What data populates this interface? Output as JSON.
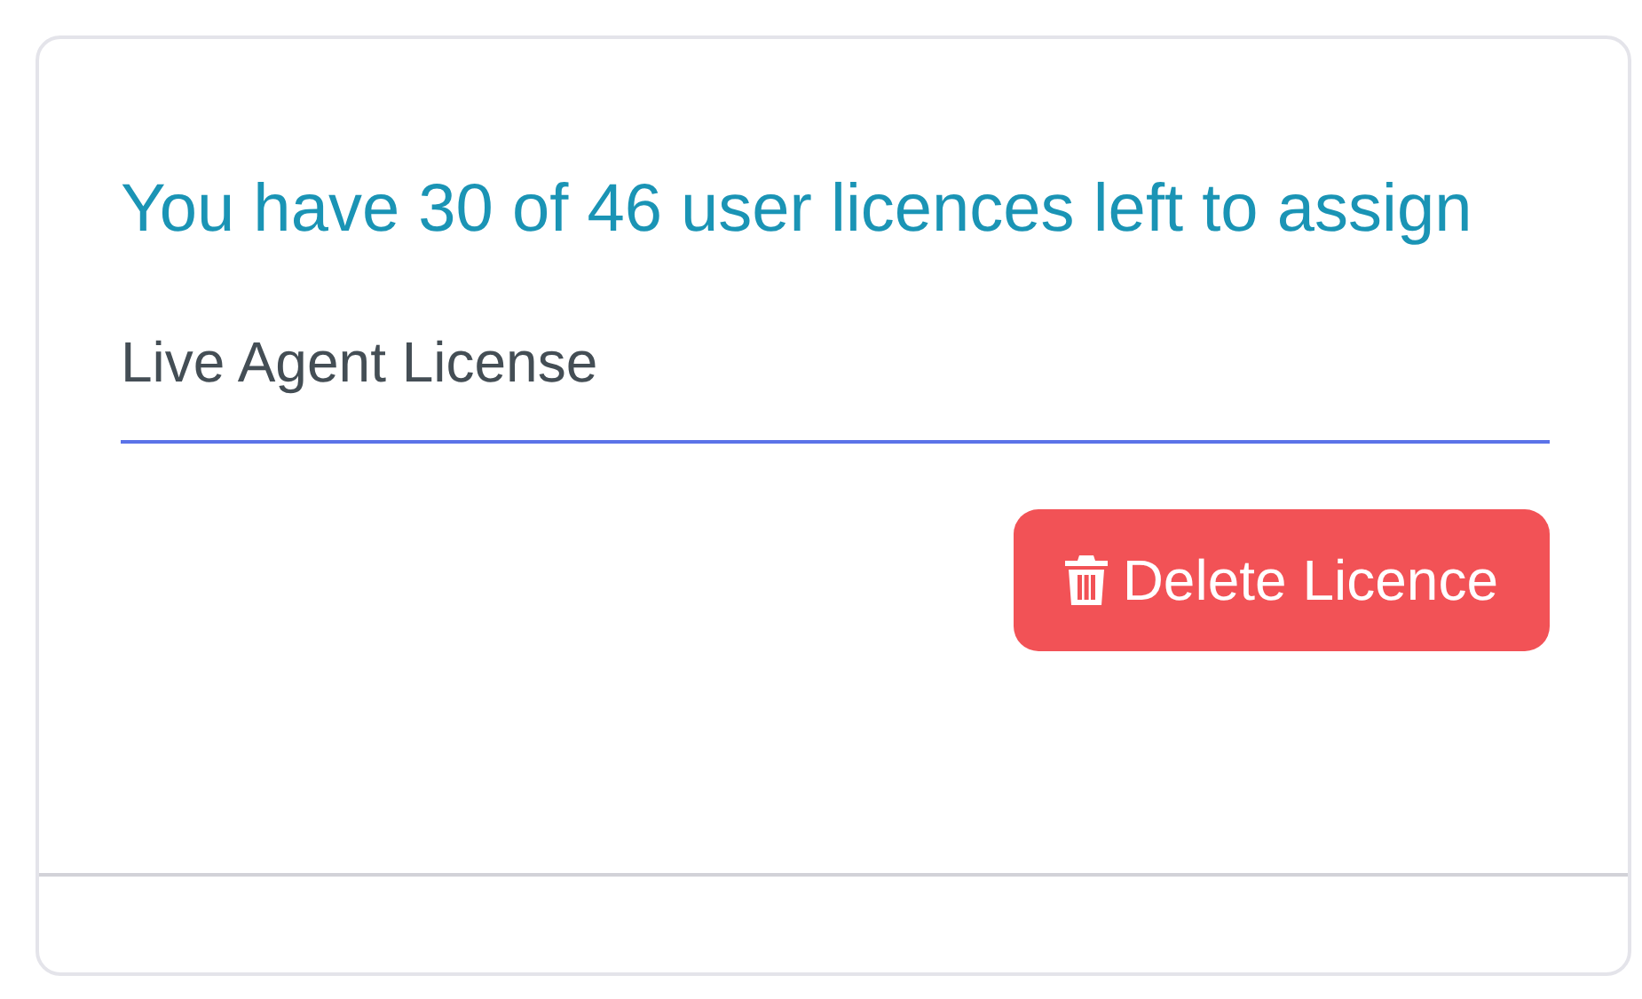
{
  "card": {
    "heading": "You have 30 of 46 user licences left to assign",
    "licence_name": "Live Agent License",
    "delete_button": {
      "label": "Delete Licence"
    }
  }
}
